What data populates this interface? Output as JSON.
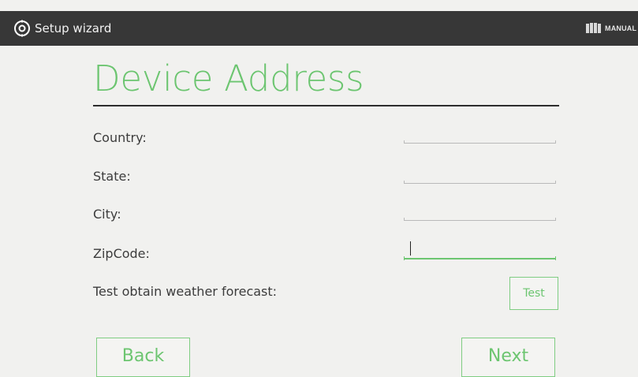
{
  "topbar": {
    "title": "Setup wizard",
    "app_icon": "gear-icon",
    "manual_icon": "book-icon",
    "manual_label": "MANUAL"
  },
  "page": {
    "title": "Device Address"
  },
  "form": {
    "country": {
      "label": "Country:",
      "value": ""
    },
    "state": {
      "label": "State:",
      "value": ""
    },
    "city": {
      "label": "City:",
      "value": ""
    },
    "zipcode": {
      "label": "ZipCode:",
      "value": ""
    },
    "test": {
      "label": "Test obtain weather forecast:",
      "button": "Test"
    }
  },
  "nav": {
    "back": "Back",
    "next": "Next"
  },
  "colors": {
    "accent": "#6cc570",
    "topbar": "#373737",
    "background": "#f1f1ef"
  }
}
